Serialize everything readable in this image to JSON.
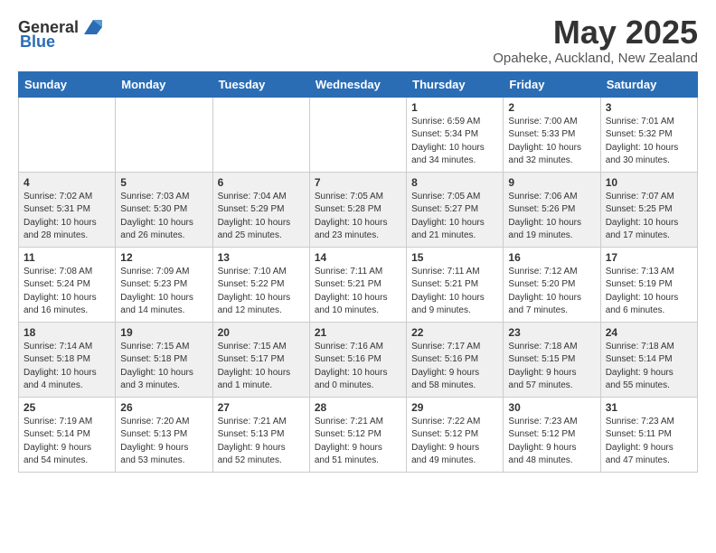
{
  "header": {
    "logo_general": "General",
    "logo_blue": "Blue",
    "title": "May 2025",
    "location": "Opaheke, Auckland, New Zealand"
  },
  "weekdays": [
    "Sunday",
    "Monday",
    "Tuesday",
    "Wednesday",
    "Thursday",
    "Friday",
    "Saturday"
  ],
  "rows": [
    [
      {
        "day": "",
        "info": ""
      },
      {
        "day": "",
        "info": ""
      },
      {
        "day": "",
        "info": ""
      },
      {
        "day": "",
        "info": ""
      },
      {
        "day": "1",
        "info": "Sunrise: 6:59 AM\nSunset: 5:34 PM\nDaylight: 10 hours\nand 34 minutes."
      },
      {
        "day": "2",
        "info": "Sunrise: 7:00 AM\nSunset: 5:33 PM\nDaylight: 10 hours\nand 32 minutes."
      },
      {
        "day": "3",
        "info": "Sunrise: 7:01 AM\nSunset: 5:32 PM\nDaylight: 10 hours\nand 30 minutes."
      }
    ],
    [
      {
        "day": "4",
        "info": "Sunrise: 7:02 AM\nSunset: 5:31 PM\nDaylight: 10 hours\nand 28 minutes."
      },
      {
        "day": "5",
        "info": "Sunrise: 7:03 AM\nSunset: 5:30 PM\nDaylight: 10 hours\nand 26 minutes."
      },
      {
        "day": "6",
        "info": "Sunrise: 7:04 AM\nSunset: 5:29 PM\nDaylight: 10 hours\nand 25 minutes."
      },
      {
        "day": "7",
        "info": "Sunrise: 7:05 AM\nSunset: 5:28 PM\nDaylight: 10 hours\nand 23 minutes."
      },
      {
        "day": "8",
        "info": "Sunrise: 7:05 AM\nSunset: 5:27 PM\nDaylight: 10 hours\nand 21 minutes."
      },
      {
        "day": "9",
        "info": "Sunrise: 7:06 AM\nSunset: 5:26 PM\nDaylight: 10 hours\nand 19 minutes."
      },
      {
        "day": "10",
        "info": "Sunrise: 7:07 AM\nSunset: 5:25 PM\nDaylight: 10 hours\nand 17 minutes."
      }
    ],
    [
      {
        "day": "11",
        "info": "Sunrise: 7:08 AM\nSunset: 5:24 PM\nDaylight: 10 hours\nand 16 minutes."
      },
      {
        "day": "12",
        "info": "Sunrise: 7:09 AM\nSunset: 5:23 PM\nDaylight: 10 hours\nand 14 minutes."
      },
      {
        "day": "13",
        "info": "Sunrise: 7:10 AM\nSunset: 5:22 PM\nDaylight: 10 hours\nand 12 minutes."
      },
      {
        "day": "14",
        "info": "Sunrise: 7:11 AM\nSunset: 5:21 PM\nDaylight: 10 hours\nand 10 minutes."
      },
      {
        "day": "15",
        "info": "Sunrise: 7:11 AM\nSunset: 5:21 PM\nDaylight: 10 hours\nand 9 minutes."
      },
      {
        "day": "16",
        "info": "Sunrise: 7:12 AM\nSunset: 5:20 PM\nDaylight: 10 hours\nand 7 minutes."
      },
      {
        "day": "17",
        "info": "Sunrise: 7:13 AM\nSunset: 5:19 PM\nDaylight: 10 hours\nand 6 minutes."
      }
    ],
    [
      {
        "day": "18",
        "info": "Sunrise: 7:14 AM\nSunset: 5:18 PM\nDaylight: 10 hours\nand 4 minutes."
      },
      {
        "day": "19",
        "info": "Sunrise: 7:15 AM\nSunset: 5:18 PM\nDaylight: 10 hours\nand 3 minutes."
      },
      {
        "day": "20",
        "info": "Sunrise: 7:15 AM\nSunset: 5:17 PM\nDaylight: 10 hours\nand 1 minute."
      },
      {
        "day": "21",
        "info": "Sunrise: 7:16 AM\nSunset: 5:16 PM\nDaylight: 10 hours\nand 0 minutes."
      },
      {
        "day": "22",
        "info": "Sunrise: 7:17 AM\nSunset: 5:16 PM\nDaylight: 9 hours\nand 58 minutes."
      },
      {
        "day": "23",
        "info": "Sunrise: 7:18 AM\nSunset: 5:15 PM\nDaylight: 9 hours\nand 57 minutes."
      },
      {
        "day": "24",
        "info": "Sunrise: 7:18 AM\nSunset: 5:14 PM\nDaylight: 9 hours\nand 55 minutes."
      }
    ],
    [
      {
        "day": "25",
        "info": "Sunrise: 7:19 AM\nSunset: 5:14 PM\nDaylight: 9 hours\nand 54 minutes."
      },
      {
        "day": "26",
        "info": "Sunrise: 7:20 AM\nSunset: 5:13 PM\nDaylight: 9 hours\nand 53 minutes."
      },
      {
        "day": "27",
        "info": "Sunrise: 7:21 AM\nSunset: 5:13 PM\nDaylight: 9 hours\nand 52 minutes."
      },
      {
        "day": "28",
        "info": "Sunrise: 7:21 AM\nSunset: 5:12 PM\nDaylight: 9 hours\nand 51 minutes."
      },
      {
        "day": "29",
        "info": "Sunrise: 7:22 AM\nSunset: 5:12 PM\nDaylight: 9 hours\nand 49 minutes."
      },
      {
        "day": "30",
        "info": "Sunrise: 7:23 AM\nSunset: 5:12 PM\nDaylight: 9 hours\nand 48 minutes."
      },
      {
        "day": "31",
        "info": "Sunrise: 7:23 AM\nSunset: 5:11 PM\nDaylight: 9 hours\nand 47 minutes."
      }
    ]
  ]
}
